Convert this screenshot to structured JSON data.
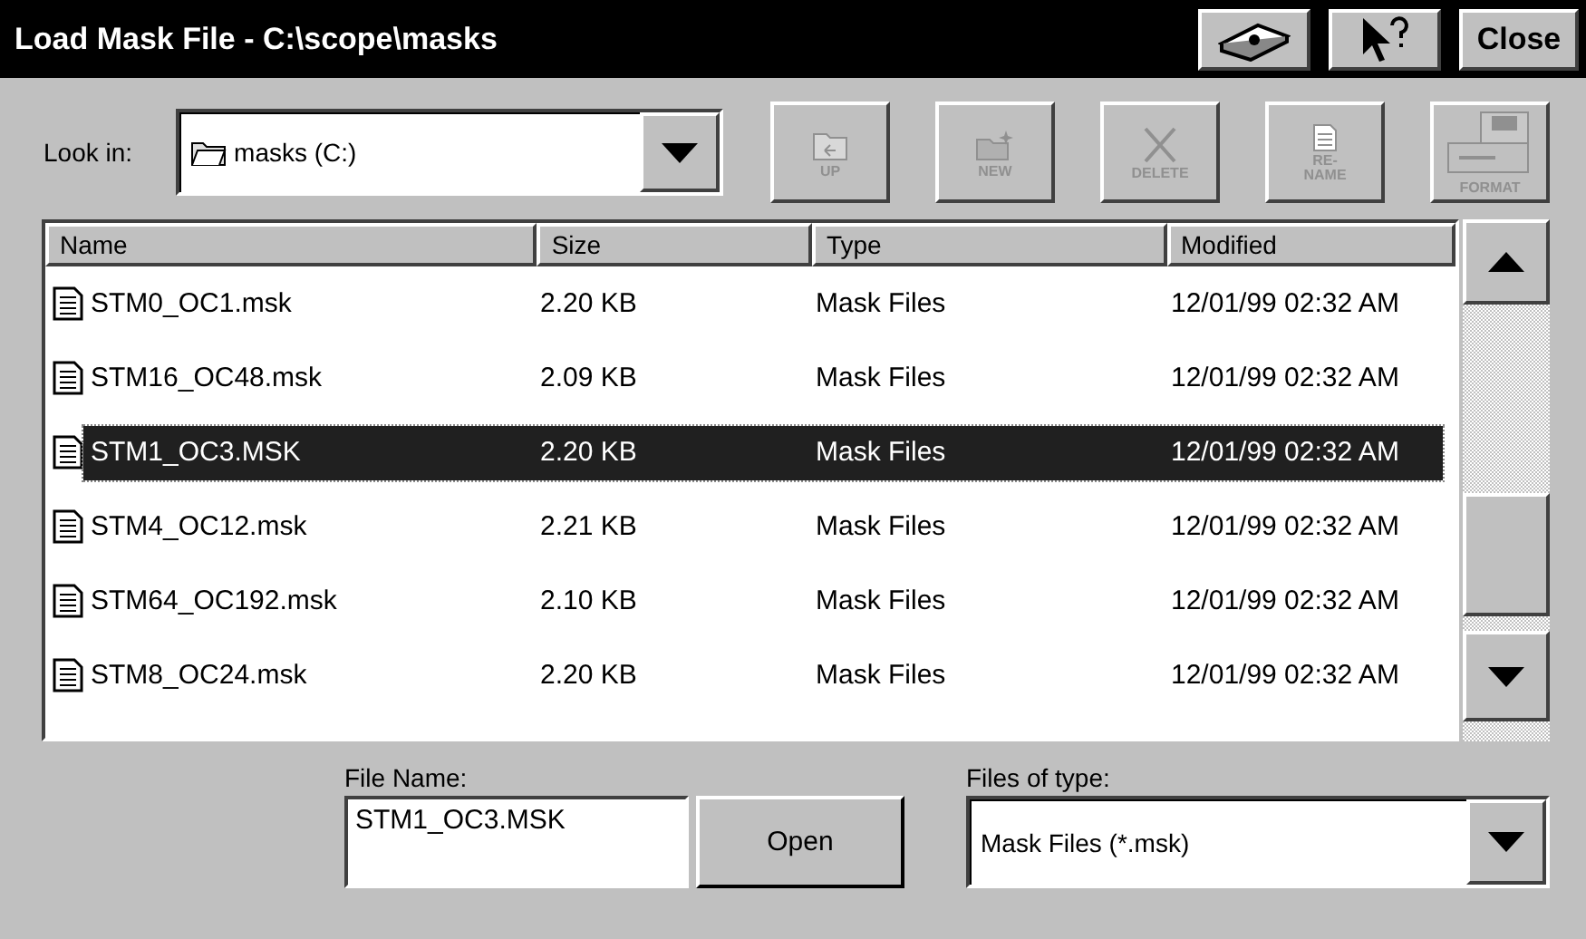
{
  "window": {
    "title": "Load Mask File - C:\\scope\\masks",
    "close_label": "Close"
  },
  "look_in": {
    "label": "Look in:",
    "value": "masks (C:)"
  },
  "toolbar": [
    {
      "kind": "up",
      "label": "UP",
      "disabled": true
    },
    {
      "kind": "new",
      "label": "NEW",
      "disabled": true
    },
    {
      "kind": "delete",
      "label": "DELETE",
      "disabled": true
    },
    {
      "kind": "rename",
      "label": "RE-\nNAME",
      "disabled": true
    },
    {
      "kind": "format",
      "label": "FORMAT",
      "disabled": true
    }
  ],
  "table": {
    "columns": [
      "Name",
      "Size",
      "Type",
      "Modified"
    ],
    "rows": [
      {
        "name": "STM0_OC1.msk",
        "size": "2.20 KB",
        "type": "Mask Files",
        "modified": "12/01/99 02:32 AM",
        "selected": false
      },
      {
        "name": "STM16_OC48.msk",
        "size": "2.09 KB",
        "type": "Mask Files",
        "modified": "12/01/99 02:32 AM",
        "selected": false
      },
      {
        "name": "STM1_OC3.MSK",
        "size": "2.20 KB",
        "type": "Mask Files",
        "modified": "12/01/99 02:32 AM",
        "selected": true
      },
      {
        "name": "STM4_OC12.msk",
        "size": "2.21 KB",
        "type": "Mask Files",
        "modified": "12/01/99 02:32 AM",
        "selected": false
      },
      {
        "name": "STM64_OC192.msk",
        "size": "2.10 KB",
        "type": "Mask Files",
        "modified": "12/01/99 02:32 AM",
        "selected": false
      },
      {
        "name": "STM8_OC24.msk",
        "size": "2.20 KB",
        "type": "Mask Files",
        "modified": "12/01/99 02:32 AM",
        "selected": false
      }
    ]
  },
  "file_name": {
    "label": "File Name:",
    "value": "STM1_OC3.MSK"
  },
  "open_button": "Open",
  "file_type": {
    "label": "Files of type:",
    "value": "Mask Files (*.msk)"
  }
}
